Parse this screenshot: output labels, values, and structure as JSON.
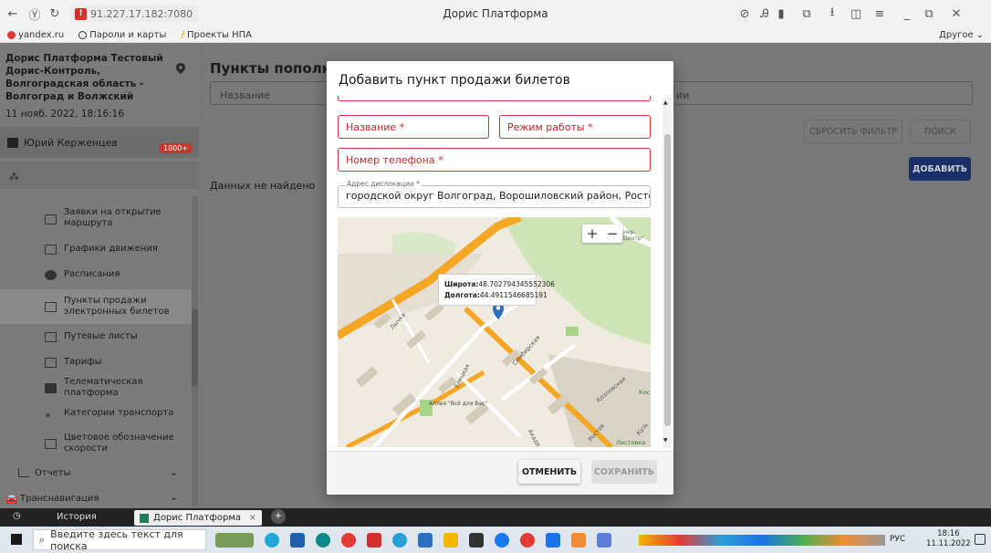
{
  "browser": {
    "url": "91.227.17.182:7080",
    "window_title": "Дорис Платформа",
    "bookmarks": [
      "yandex.ru",
      "Пароли и карты",
      "Проекты НПА"
    ],
    "bookmarks_other": "Другое"
  },
  "sidebar": {
    "org": "Дорис Платформа Тестовый Дорис-Контроль, Волгоградская область - Волгоград и Волжский",
    "datetime": "11 нояб. 2022, 18:16:16",
    "user": "Юрий Керженцев",
    "badge": "1000+",
    "items": [
      {
        "label": "Заявки на открытие маршрута"
      },
      {
        "label": "Графики движения"
      },
      {
        "label": "Расписания"
      },
      {
        "label": "Пункты продажи электронных билетов"
      },
      {
        "label": "Путевые листы"
      },
      {
        "label": "Тарифы"
      },
      {
        "label": "Телематическая платформа"
      },
      {
        "label": "Категории транспорта"
      },
      {
        "label": "Цветовое обозначение скорости"
      },
      {
        "label": "Отчеты"
      },
      {
        "label": "Транснавигация"
      }
    ]
  },
  "main": {
    "title": "Пункты пополнени",
    "filter_placeholder": "Название",
    "filter_right": "ии",
    "reset_filter": "СБРОСИТЬ ФИЛЬТР",
    "search": "ПОИСК",
    "add": "ДОБАВИТЬ",
    "empty": "Данных не найдено"
  },
  "modal": {
    "title": "Добавить пункт продажи билетов",
    "name_field": "Название *",
    "hours_field": "Режим работы *",
    "phone_field": "Номер телефона *",
    "address_label": "Адрес дислокации *",
    "address_value": "городской округ Волгоград, Ворошиловский район, Ростовская ули",
    "zoom_in": "+",
    "zoom_out": "−",
    "lat_label": "Широта:",
    "lat_value": "48.702794345552306",
    "lon_label": "Долгота:",
    "lon_value": "44.4911546685191",
    "cancel": "ОТМЕНИТЬ",
    "save": "СОХРАНИТЬ"
  },
  "map_labels": {
    "street1": "Лычка",
    "street2": "Елецкая",
    "street3": "Симбирская",
    "street4": "Козловская",
    "alley": "Аллея \"Всё для Вас\"",
    "store": "Листовка",
    "center": "нер-Центр\"",
    "kos": "Кос",
    "akad": "Акаде",
    "rosto": "Ростов",
    "kuz": "Кузь"
  },
  "history_bar": {
    "history": "История",
    "tab": "Дорис Платформа"
  },
  "taskbar": {
    "search": "Введите здесь текст для поиска",
    "lang": "РУС",
    "time": "18:16",
    "date": "11.11.2022"
  }
}
